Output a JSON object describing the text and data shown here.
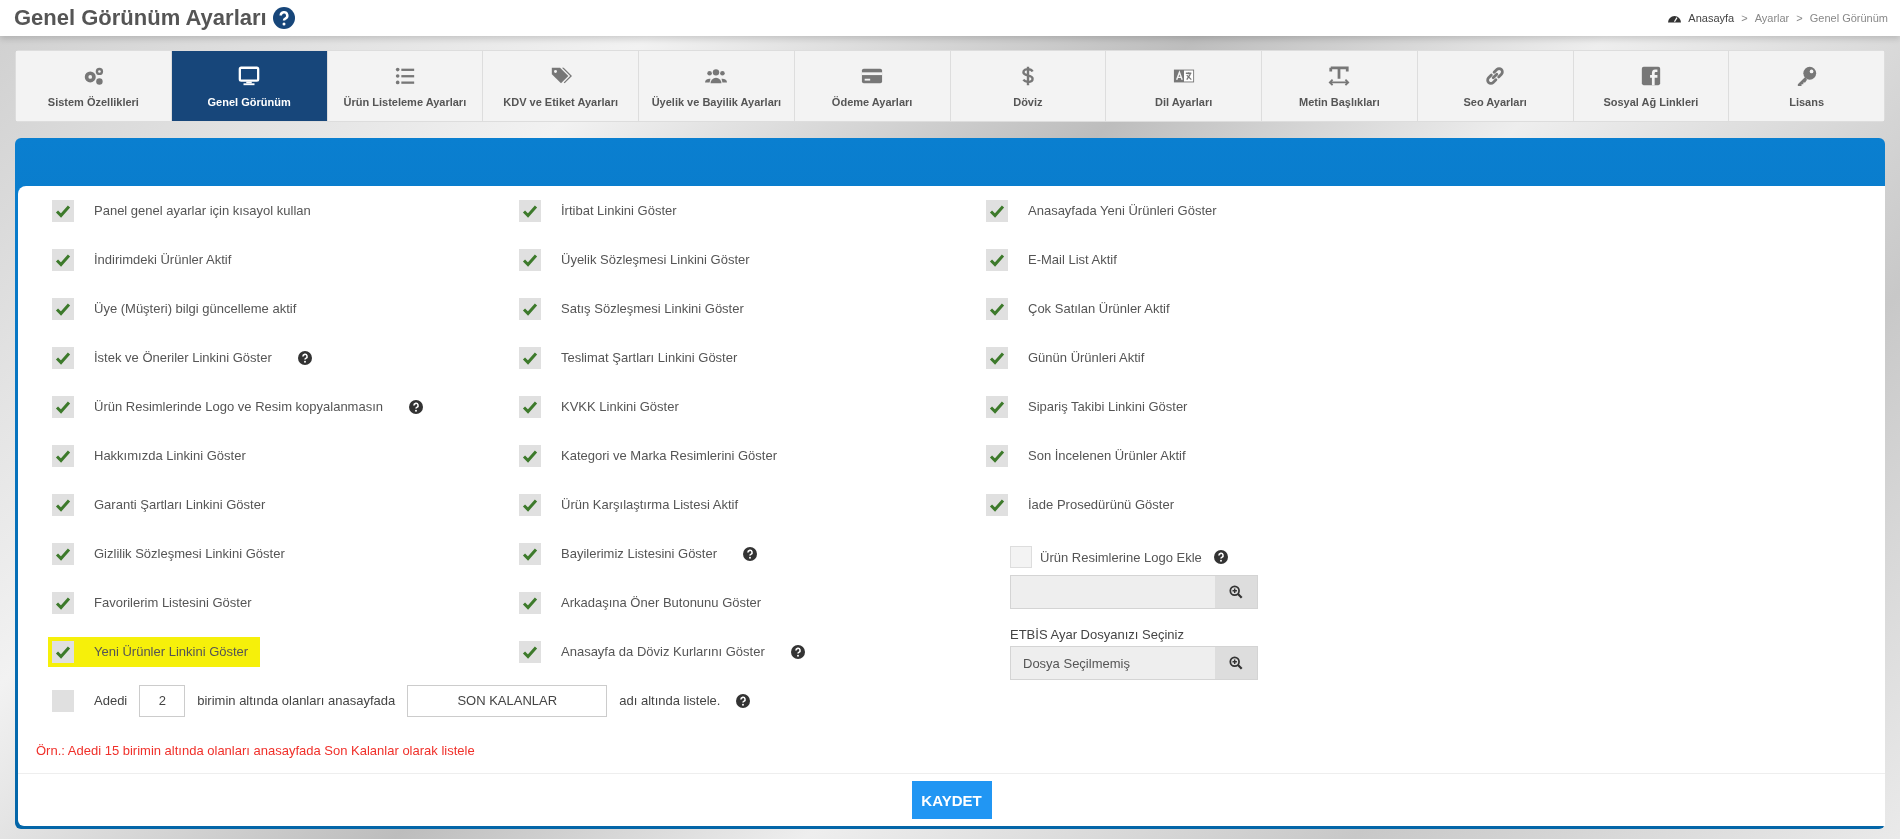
{
  "page": {
    "title": "Genel Görünüm Ayarları",
    "help": true
  },
  "breadcrumb": {
    "separator": ">",
    "items": [
      "Anasayfa",
      "Ayarlar",
      "Genel Görünüm"
    ]
  },
  "tabs": [
    {
      "label": "Sistem Özellikleri",
      "selected": false
    },
    {
      "label": "Genel Görünüm",
      "selected": true
    },
    {
      "label": "Ürün Listeleme Ayarları",
      "selected": false
    },
    {
      "label": "KDV ve Etiket Ayarları",
      "selected": false
    },
    {
      "label": "Üyelik ve Bayilik Ayarları",
      "selected": false
    },
    {
      "label": "Ödeme Ayarları",
      "selected": false
    },
    {
      "label": "Döviz",
      "selected": false
    },
    {
      "label": "Dil Ayarları",
      "selected": false
    },
    {
      "label": "Metin Başlıkları",
      "selected": false
    },
    {
      "label": "Seo Ayarları",
      "selected": false
    },
    {
      "label": "Sosyal Ağ Linkleri",
      "selected": false
    },
    {
      "label": "Lisans",
      "selected": false
    }
  ],
  "option_columns": [
    [
      {
        "label": "Panel genel ayarlar için kısayol kullan",
        "checked": true,
        "help": false,
        "highlighted": false
      },
      {
        "label": "İndirimdeki Ürünler Aktif",
        "checked": true,
        "help": false,
        "highlighted": false
      },
      {
        "label": "Üye (Müşteri) bilgi güncelleme aktif",
        "checked": true,
        "help": false,
        "highlighted": false
      },
      {
        "label": "İstek ve Öneriler Linkini Göster",
        "checked": true,
        "help": true,
        "highlighted": false
      },
      {
        "label": "Ürün Resimlerinde Logo ve Resim kopyalanmasın",
        "checked": true,
        "help": true,
        "highlighted": false
      },
      {
        "label": "Hakkımızda Linkini Göster",
        "checked": true,
        "help": false,
        "highlighted": false
      },
      {
        "label": "Garanti Şartları Linkini Göster",
        "checked": true,
        "help": false,
        "highlighted": false
      },
      {
        "label": "Gizlilik Sözleşmesi Linkini Göster",
        "checked": true,
        "help": false,
        "highlighted": false
      },
      {
        "label": "Favorilerim Listesini Göster",
        "checked": true,
        "help": false,
        "highlighted": false
      },
      {
        "label": "Yeni Ürünler Linkini Göster",
        "checked": true,
        "help": false,
        "highlighted": true
      }
    ],
    [
      {
        "label": "İrtibat Linkini Göster",
        "checked": true,
        "help": false,
        "highlighted": false
      },
      {
        "label": "Üyelik Sözleşmesi Linkini Göster",
        "checked": true,
        "help": false,
        "highlighted": false
      },
      {
        "label": "Satış Sözleşmesi Linkini Göster",
        "checked": true,
        "help": false,
        "highlighted": false
      },
      {
        "label": "Teslimat Şartları Linkini Göster",
        "checked": true,
        "help": false,
        "highlighted": false
      },
      {
        "label": "KVKK Linkini Göster",
        "checked": true,
        "help": false,
        "highlighted": false
      },
      {
        "label": "Kategori ve Marka Resimlerini Göster",
        "checked": true,
        "help": false,
        "highlighted": false
      },
      {
        "label": "Ürün Karşılaştırma Listesi Aktif",
        "checked": true,
        "help": false,
        "highlighted": false
      },
      {
        "label": "Bayilerimiz Listesini Göster",
        "checked": true,
        "help": true,
        "highlighted": false
      },
      {
        "label": "Arkadaşına Öner Butonunu Göster",
        "checked": true,
        "help": false,
        "highlighted": false
      },
      {
        "label": "Anasayfa da Döviz Kurlarını Göster",
        "checked": true,
        "help": true,
        "highlighted": false
      }
    ],
    [
      {
        "label": "Anasayfada Yeni Ürünleri Göster",
        "checked": true,
        "help": false,
        "highlighted": false
      },
      {
        "label": "E-Mail List Aktif",
        "checked": true,
        "help": false,
        "highlighted": false
      },
      {
        "label": "Çok Satılan Ürünler Aktif",
        "checked": true,
        "help": false,
        "highlighted": false
      },
      {
        "label": "Günün Ürünleri Aktif",
        "checked": true,
        "help": false,
        "highlighted": false
      },
      {
        "label": "Sipariş Takibi Linkini Göster",
        "checked": true,
        "help": false,
        "highlighted": false
      },
      {
        "label": "Son İncelenen Ürünler Aktif",
        "checked": true,
        "help": false,
        "highlighted": false
      },
      {
        "label": "İade Prosedürünü Göster",
        "checked": true,
        "help": false,
        "highlighted": false
      }
    ]
  ],
  "logo_option": {
    "label": "Ürün Resimlerine Logo Ekle",
    "checked": false,
    "disabled": true,
    "help": true
  },
  "etbis": {
    "label": "ETBİS Ayar Dosyanızı Seçiniz",
    "file_name": "Dosya Seçilmemiş"
  },
  "stock_row": {
    "checked": false,
    "prefix": "Adedi",
    "quantity": "2",
    "middle": "birimin altında olanları anasayfada",
    "name": "SON KALANLAR",
    "suffix": "adı altında listele.",
    "help": true
  },
  "note": "Örn.: Adedi 15 birimin altında olanları anasayfada Son Kalanlar olarak listele",
  "save_button": "KAYDET"
}
